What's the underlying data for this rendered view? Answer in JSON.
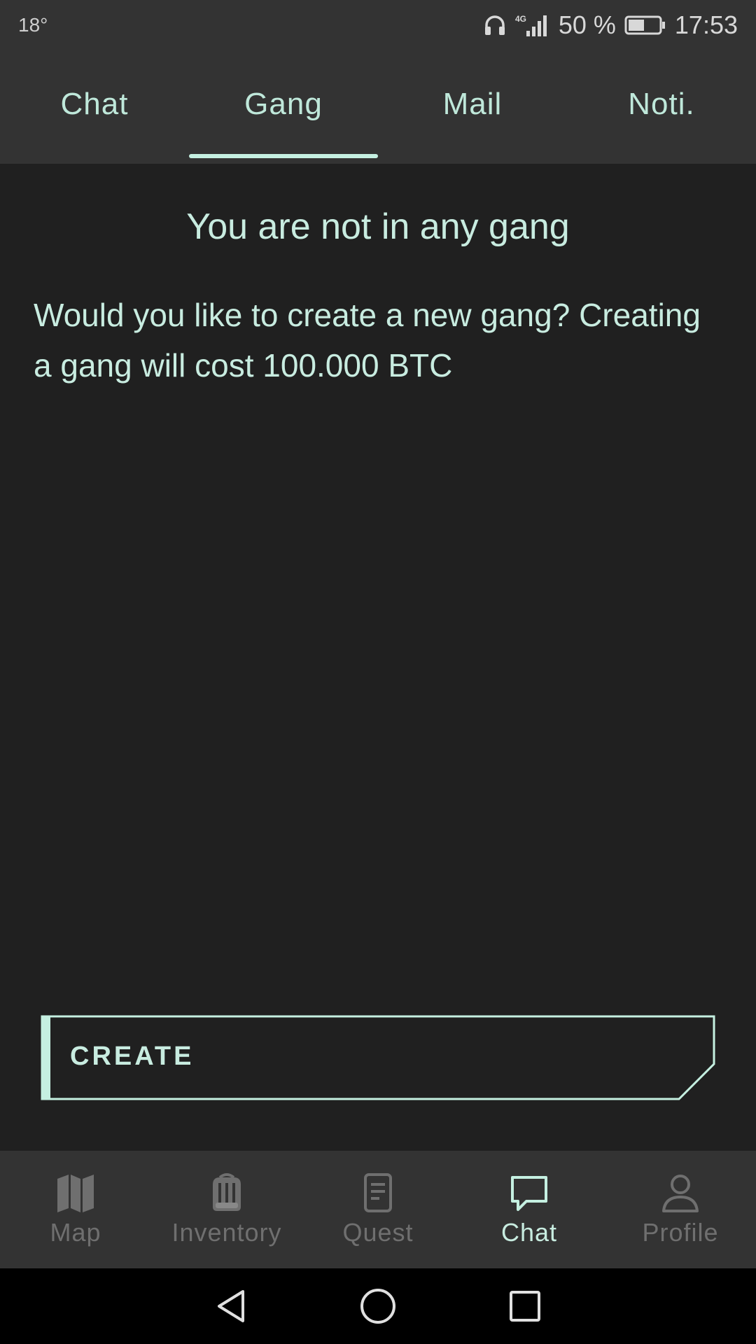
{
  "status_bar": {
    "temperature": "18°",
    "battery": "50 %",
    "time": "17:53",
    "network": "4G",
    "icons": [
      "headset-icon",
      "signal-icon",
      "battery-icon"
    ]
  },
  "top_tabs": [
    {
      "label": "Chat",
      "active": false
    },
    {
      "label": "Gang",
      "active": true
    },
    {
      "label": "Mail",
      "active": false
    },
    {
      "label": "Noti.",
      "active": false
    }
  ],
  "main": {
    "title": "You are not in any gang",
    "description": "Would you like to create a new gang? Creating a gang will cost 100.000 BTC",
    "create_label": "CREATE"
  },
  "bottom_nav": [
    {
      "label": "Map",
      "icon": "map-icon",
      "active": false
    },
    {
      "label": "Inventory",
      "icon": "backpack-icon",
      "active": false
    },
    {
      "label": "Quest",
      "icon": "document-icon",
      "active": false
    },
    {
      "label": "Chat",
      "icon": "chat-bubble-icon",
      "active": true
    },
    {
      "label": "Profile",
      "icon": "person-icon",
      "active": false
    }
  ],
  "colors": {
    "accent": "#c5f0e1",
    "background": "#202020",
    "bar": "#333333",
    "inactive": "#6f6f6f"
  }
}
